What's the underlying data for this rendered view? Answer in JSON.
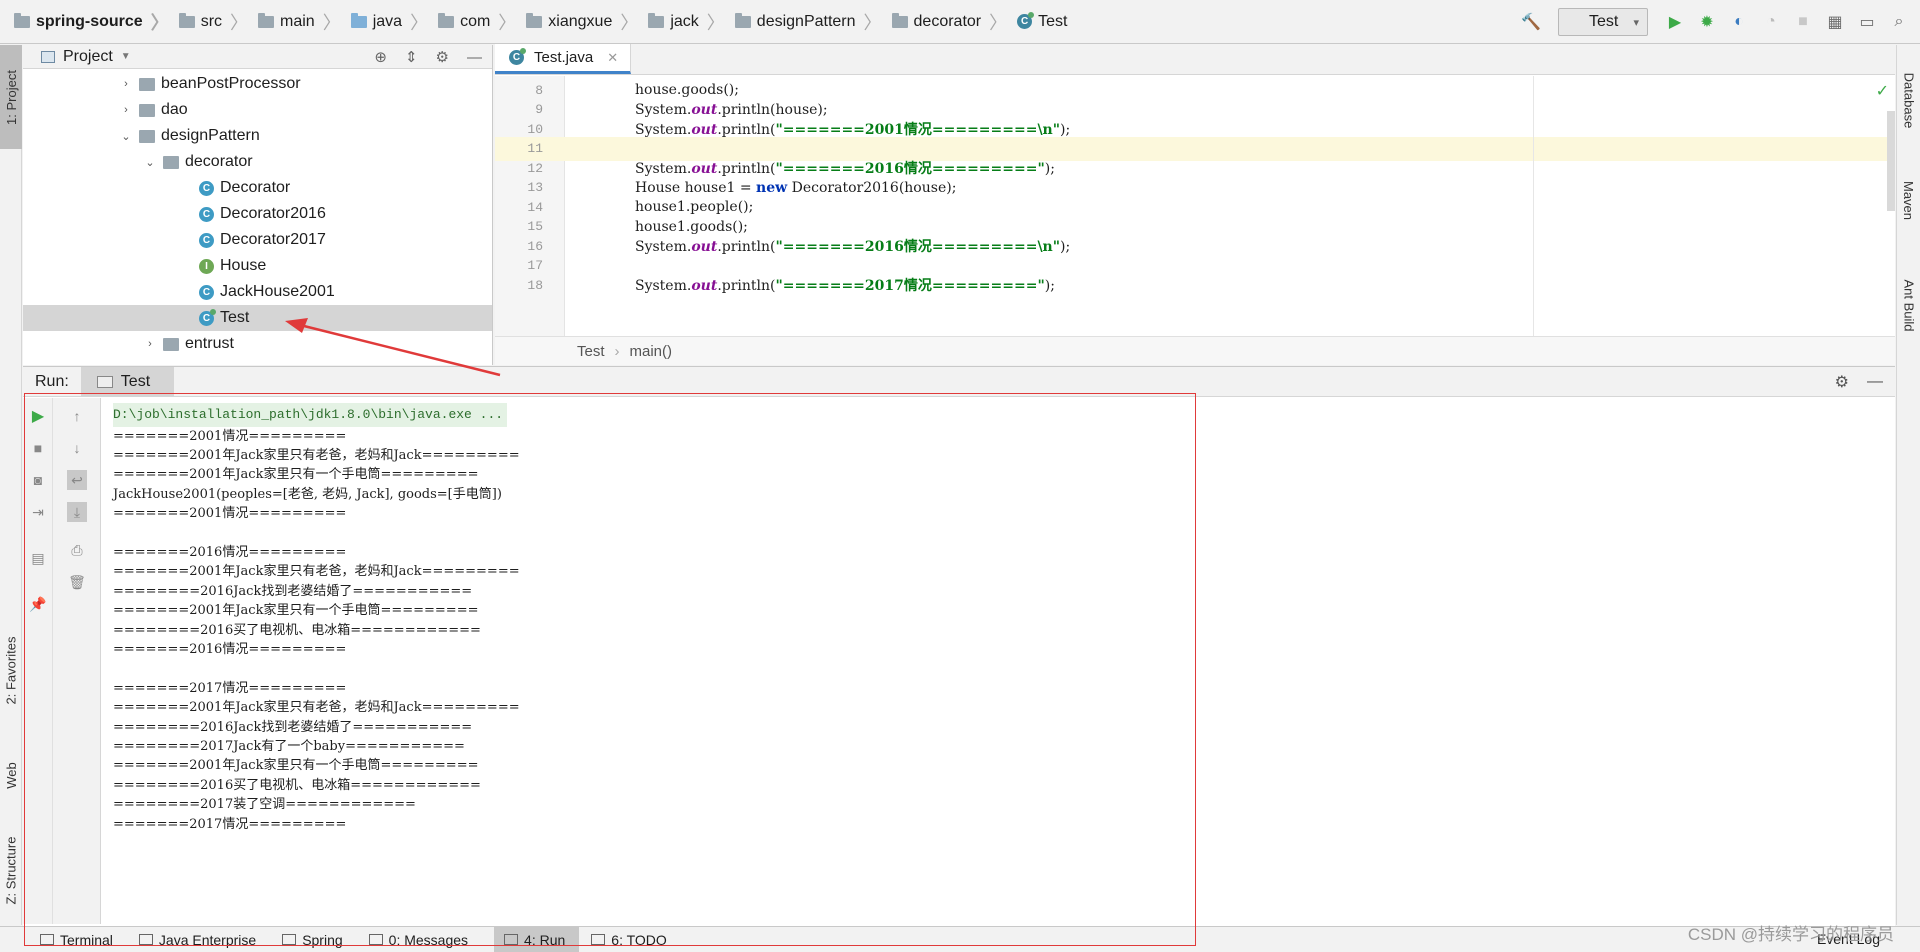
{
  "breadcrumb": [
    {
      "label": "spring-source",
      "bold": true,
      "icon": "project-folder-icon"
    },
    {
      "label": "src",
      "icon": "folder-icon"
    },
    {
      "label": "main",
      "icon": "folder-icon"
    },
    {
      "label": "java",
      "icon": "source-folder-icon"
    },
    {
      "label": "com",
      "icon": "folder-icon"
    },
    {
      "label": "xiangxue",
      "icon": "folder-icon"
    },
    {
      "label": "jack",
      "icon": "folder-icon"
    },
    {
      "label": "designPattern",
      "icon": "folder-icon"
    },
    {
      "label": "decorator",
      "icon": "folder-icon"
    },
    {
      "label": "Test",
      "icon": "class-icon"
    }
  ],
  "toolbar": {
    "run_config": "Test"
  },
  "left_strip": {
    "project": "1: Project",
    "favorites": "2: Favorites",
    "web": "Web",
    "structure": "Z: Structure"
  },
  "right_strip": {
    "database": "Database",
    "maven": "Maven",
    "ant": "Ant Build"
  },
  "project_panel": {
    "title": "Project",
    "tree": [
      {
        "label": "beanPostProcessor",
        "kind": "folder",
        "depth": 0,
        "arrow": "›"
      },
      {
        "label": "dao",
        "kind": "folder",
        "depth": 0,
        "arrow": "›"
      },
      {
        "label": "designPattern",
        "kind": "folder",
        "depth": 0,
        "arrow": "⌄"
      },
      {
        "label": "decorator",
        "kind": "folder",
        "depth": 1,
        "arrow": "⌄"
      },
      {
        "label": "Decorator",
        "kind": "class",
        "depth": 2,
        "arrow": ""
      },
      {
        "label": "Decorator2016",
        "kind": "class",
        "depth": 2,
        "arrow": ""
      },
      {
        "label": "Decorator2017",
        "kind": "class",
        "depth": 2,
        "arrow": ""
      },
      {
        "label": "House",
        "kind": "interface",
        "depth": 2,
        "arrow": ""
      },
      {
        "label": "JackHouse2001",
        "kind": "class",
        "depth": 2,
        "arrow": ""
      },
      {
        "label": "Test",
        "kind": "class-run",
        "depth": 2,
        "arrow": "",
        "selected": true
      },
      {
        "label": "entrust",
        "kind": "folder",
        "depth": 1,
        "arrow": "›"
      }
    ]
  },
  "editor": {
    "tab_label": "Test.java",
    "lines": [
      {
        "num": "8",
        "parts": [
          [
            "",
            "house.goods();"
          ]
        ]
      },
      {
        "num": "9",
        "parts": [
          [
            "",
            "System."
          ],
          [
            "fld",
            "out"
          ],
          [
            "",
            ".println(house);"
          ]
        ]
      },
      {
        "num": "10",
        "parts": [
          [
            "",
            "System."
          ],
          [
            "fld",
            "out"
          ],
          [
            "",
            ".println("
          ],
          [
            "str",
            "\"=======2001情况=========\\n\""
          ],
          [
            "",
            ");"
          ]
        ]
      },
      {
        "num": "11",
        "parts": [],
        "current": true
      },
      {
        "num": "12",
        "parts": [
          [
            "",
            "System."
          ],
          [
            "fld",
            "out"
          ],
          [
            "",
            ".println("
          ],
          [
            "str",
            "\"=======2016情况=========\""
          ],
          [
            "",
            ");"
          ]
        ]
      },
      {
        "num": "13",
        "parts": [
          [
            "",
            "House house1 = "
          ],
          [
            "kw",
            "new"
          ],
          [
            "",
            " Decorator2016(house);"
          ]
        ]
      },
      {
        "num": "14",
        "parts": [
          [
            "",
            "house1.people();"
          ]
        ]
      },
      {
        "num": "15",
        "parts": [
          [
            "",
            "house1.goods();"
          ]
        ]
      },
      {
        "num": "16",
        "parts": [
          [
            "",
            "System."
          ],
          [
            "fld",
            "out"
          ],
          [
            "",
            ".println("
          ],
          [
            "str",
            "\"=======2016情况=========\\n\""
          ],
          [
            "",
            ");"
          ]
        ]
      },
      {
        "num": "17",
        "parts": []
      },
      {
        "num": "18",
        "parts": [
          [
            "",
            "System."
          ],
          [
            "fld",
            "out"
          ],
          [
            "",
            ".println("
          ],
          [
            "str",
            "\"=======2017情况=========\""
          ],
          [
            "",
            ");"
          ]
        ]
      }
    ],
    "breadcrumb_class": "Test",
    "breadcrumb_method": "main()"
  },
  "run_panel": {
    "label": "Run:",
    "tab": "Test",
    "output": [
      {
        "text": "D:\\job\\installation_path\\jdk1.8.0\\bin\\java.exe ...",
        "cmd": true
      },
      {
        "text": "=======2001情况========="
      },
      {
        "text": "=======2001年Jack家里只有老爸，老妈和Jack========="
      },
      {
        "text": "=======2001年Jack家里只有一个手电筒========="
      },
      {
        "text": "JackHouse2001(peoples=[老爸, 老妈, Jack], goods=[手电筒])"
      },
      {
        "text": "=======2001情况========="
      },
      {
        "text": ""
      },
      {
        "text": "=======2016情况========="
      },
      {
        "text": "=======2001年Jack家里只有老爸，老妈和Jack========="
      },
      {
        "text": "========2016Jack找到老婆结婚了==========="
      },
      {
        "text": "=======2001年Jack家里只有一个手电筒========="
      },
      {
        "text": "========2016买了电视机、电冰箱============"
      },
      {
        "text": "=======2016情况========="
      },
      {
        "text": ""
      },
      {
        "text": "=======2017情况========="
      },
      {
        "text": "=======2001年Jack家里只有老爸，老妈和Jack========="
      },
      {
        "text": "========2016Jack找到老婆结婚了==========="
      },
      {
        "text": "========2017Jack有了一个baby==========="
      },
      {
        "text": "=======2001年Jack家里只有一个手电筒========="
      },
      {
        "text": "========2016买了电视机、电冰箱============"
      },
      {
        "text": "========2017装了空调============"
      },
      {
        "text": "=======2017情况========="
      }
    ]
  },
  "bottom_tabs": [
    {
      "label": "Terminal"
    },
    {
      "label": "Java Enterprise"
    },
    {
      "label": "Spring"
    },
    {
      "label": "0: Messages"
    },
    {
      "label": "4: Run",
      "active": true
    },
    {
      "label": "6: TODO"
    }
  ],
  "event_log": "Event Log",
  "watermark": "CSDN @持续学习的程序员"
}
